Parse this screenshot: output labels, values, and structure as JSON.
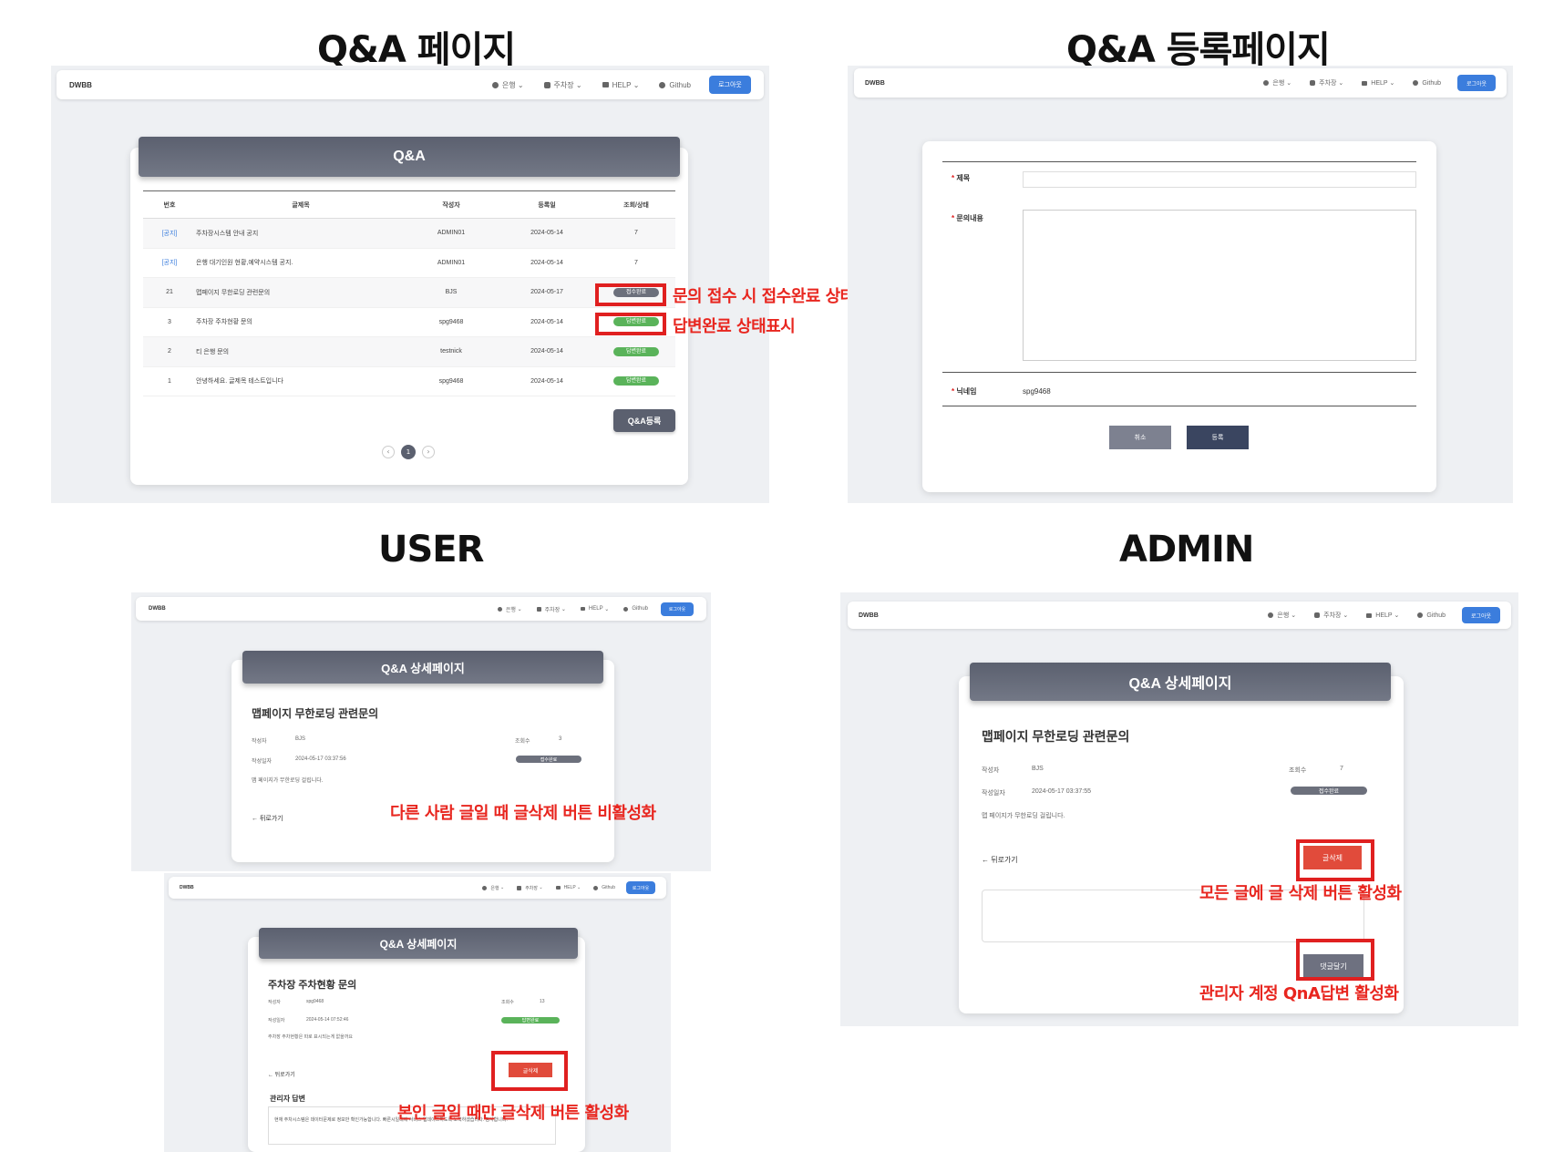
{
  "sections": {
    "qa_page": "Q&A 페이지",
    "qa_register": "Q&A 등록페이지",
    "user": "USER",
    "admin": "ADMIN"
  },
  "nav": {
    "brand": "DWBB",
    "bank": "은행",
    "parking": "주차장",
    "help": "HELP",
    "github": "Github",
    "logout": "로그아웃"
  },
  "qa_list": {
    "header": "Q&A",
    "columns": [
      "번호",
      "글제목",
      "작성자",
      "등록일",
      "조회/상태"
    ],
    "rows": [
      {
        "no": "[공지]",
        "title": "주차장시스템 안내 공지",
        "author": "ADMIN01",
        "date": "2024-05-14",
        "status": "7",
        "status_type": "text"
      },
      {
        "no": "[공지]",
        "title": "은행 대기인원 현황,예약시스템 공지.",
        "author": "ADMIN01",
        "date": "2024-05-14",
        "status": "7",
        "status_type": "text"
      },
      {
        "no": "21",
        "title": "맵페이지 무한로딩 관련문의",
        "author": "BJS",
        "date": "2024-05-17",
        "status": "접수완료",
        "status_type": "gray"
      },
      {
        "no": "3",
        "title": "주차장 주차현황 문의",
        "author": "spg9468",
        "date": "2024-05-14",
        "status": "답변완료",
        "status_type": "green"
      },
      {
        "no": "2",
        "title": "티 은행 문의",
        "author": "testnick",
        "date": "2024-05-14",
        "status": "답변완료",
        "status_type": "green"
      },
      {
        "no": "1",
        "title": "안녕하세요. 글제목 테스트입니다",
        "author": "spg9468",
        "date": "2024-05-14",
        "status": "답변완료",
        "status_type": "green"
      }
    ],
    "register_button": "Q&A등록",
    "page": "1",
    "annotation_received": "문의 접수 시 접수완료 상태표시",
    "annotation_answered": "답변완료 상태표시"
  },
  "register_form": {
    "title_label": "제목",
    "content_label": "문의내용",
    "nickname_label": "닉네임",
    "nickname_value": "spg9468",
    "cancel": "취소",
    "submit": "등록"
  },
  "user_detail_1": {
    "header": "Q&A 상세페이지",
    "title": "맵페이지 무한로딩 관련문의",
    "author_label": "작성자",
    "author": "BJS",
    "views_label": "조회수",
    "views": "3",
    "date_label": "작성일자",
    "date": "2024-05-17 03:37:56",
    "status": "접수완료",
    "content": "맵 페이지가 무한로딩 걸립니다.",
    "back": "← 뒤로가기",
    "annotation": "다른 사람 글일 때 글삭제 버튼 비활성화"
  },
  "user_detail_2": {
    "header": "Q&A 상세페이지",
    "title": "주차장 주차현황 문의",
    "author_label": "작성자",
    "author": "spg9468",
    "views_label": "조회수",
    "views": "13",
    "date_label": "작성일자",
    "date": "2024-05-14 07:52:46",
    "status": "답변완료",
    "content": "주차장 주차현황은 따로 표시되는게 없을까요",
    "back": "← 뒤로가기",
    "delete": "글삭제",
    "admin_answer_label": "관리자 답변",
    "admin_answer": "현재 주차시스템은 데이터문제로 정보만 확인가능합니다. 빠른시일내에 서비스 업데이트하도록 노력하겠습니다. 감사합니다.",
    "annotation": "본인 글일 때만 글삭제 버튼 활성화"
  },
  "admin_detail": {
    "header": "Q&A 상세페이지",
    "title": "맵페이지 무한로딩 관련문의",
    "author_label": "작성자",
    "author": "BJS",
    "views_label": "조회수",
    "views": "7",
    "date_label": "작성일자",
    "date": "2024-05-17 03:37:55",
    "status": "접수완료",
    "content": "맵 페이지가 무한로딩 걸립니다.",
    "back": "← 뒤로가기",
    "delete": "글삭제",
    "reply": "댓글달기",
    "annotation_delete": "모든 글에 글 삭제 버튼 활성화",
    "annotation_reply": "관리자 계정 QnA답변 활성화"
  }
}
